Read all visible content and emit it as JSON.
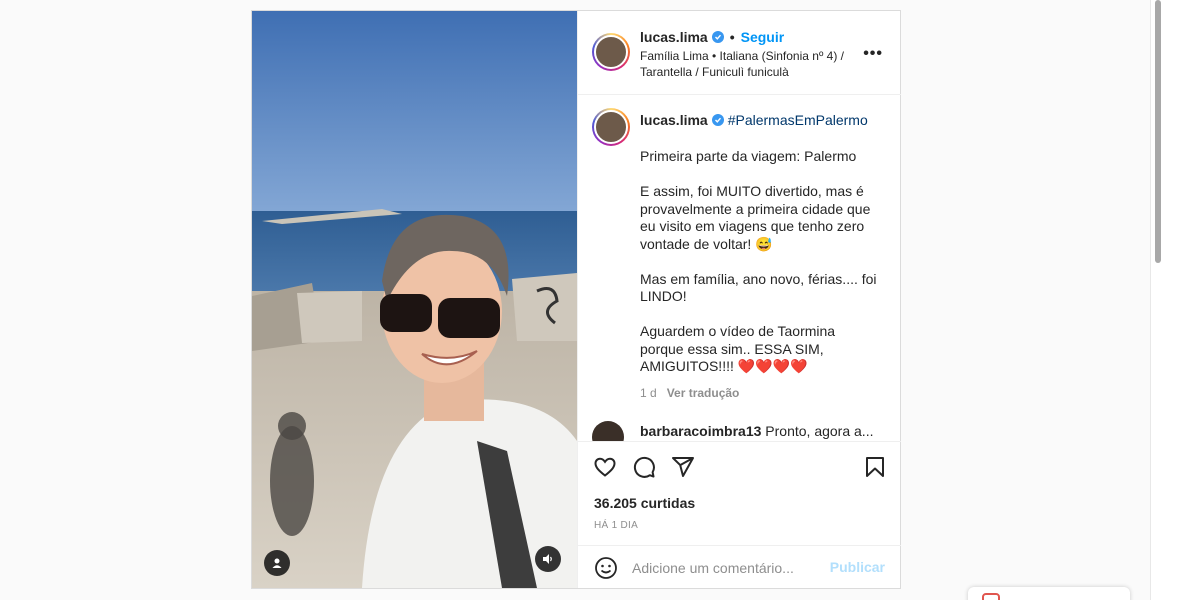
{
  "post": {
    "header": {
      "username": "lucas.lima",
      "follow_label": "Seguir",
      "audio": "Família Lima • Italiana (Sinfonia nº 4) / Tarantella / Funiculì funiculà",
      "more_label": "•••",
      "separator": "•"
    },
    "caption": {
      "username": "lucas.lima",
      "hashtag": "#PalermasEmPalermo",
      "text": "Primeira parte da viagem: Palermo\n\nE assim, foi MUITO divertido, mas é provavelmente a primeira cidade que eu visito em viagens que tenho zero vontade de voltar! 😅\n\nMas em família, ano novo, férias.... foi LINDO!\n\nAguardem o vídeo de Taormina porque essa sim.. ESSA SIM, AMIGUITOS!!!! ❤️❤️❤️❤️",
      "age": "1 d",
      "translate_label": "Ver tradução"
    },
    "next_comment": {
      "username": "barbaracoimbra13",
      "text": "Pronto, agora a..."
    },
    "actions": {
      "likes": "36.205 curtidas",
      "posted": "HÁ 1 DIA"
    },
    "comment_box": {
      "placeholder": "Adicione um comentário...",
      "publish_label": "Publicar"
    }
  },
  "icons": [
    "heart-icon",
    "comment-icon",
    "share-icon",
    "bookmark-icon",
    "emoji-icon",
    "user-tag-icon",
    "sound-icon",
    "verified-icon",
    "more-icon"
  ],
  "colors": {
    "link_blue": "#0095f6",
    "publish_disabled": "#b2dffc",
    "hashtag": "#00376b",
    "muted": "#8e8e8e",
    "verified": "#3897f0"
  }
}
